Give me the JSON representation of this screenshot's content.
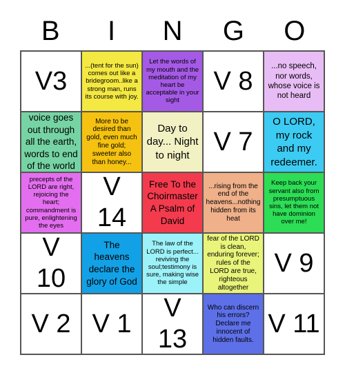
{
  "header": {
    "letters": [
      "B",
      "I",
      "N",
      "G",
      "O"
    ]
  },
  "cells": [
    {
      "text": "V3",
      "bg": "#ffffff"
    },
    {
      "text": "...(tent for the sun) comes out like a bridegroom..like a strong man, runs its course with joy.",
      "bg": "#f4e842"
    },
    {
      "text": "Let the words of my mouth and the meditation of my heart be acceptable in your sight",
      "bg": "#a55ae6"
    },
    {
      "text": "V 8",
      "bg": "#ffffff"
    },
    {
      "text": "...no speech, nor words, whose voice is not heard",
      "bg": "#e8bdf5"
    },
    {
      "text": "voice goes out through all the earth, words to end of the world",
      "bg": "#76d4a4"
    },
    {
      "text": "More to be desired than gold, even much fine gold; sweeter also than honey...",
      "bg": "#f5c211"
    },
    {
      "text": "Day to day... Night to night",
      "bg": "#f1f1c4"
    },
    {
      "text": "V 7",
      "bg": "#ffffff"
    },
    {
      "text": "O LORD, my rock and my redeemer.",
      "bg": "#3ccbf2"
    },
    {
      "text": "precepts of the LORD are right, rejoicing the heart; commandment is pure, enlightening the eyes",
      "bg": "#e46ef0"
    },
    {
      "text": "V 14",
      "bg": "#ffffff"
    },
    {
      "text": "Free To the Choirmaster A Psalm of David",
      "bg": "#f43b4e"
    },
    {
      "text": "...rising from the end of the heavens...nothing hidden from its heat",
      "bg": "#efb08a"
    },
    {
      "text": "Keep back your servant also from presumptuous sins, let them not have dominion over me!",
      "bg": "#2cdd55"
    },
    {
      "text": "V 10",
      "bg": "#ffffff"
    },
    {
      "text": "The heavens declare the glory of God",
      "bg": "#12a1e6"
    },
    {
      "text": "The law of the LORD is perfect... reviving the soul;testimony is sure, making wise the simple",
      "bg": "#9cf2f9"
    },
    {
      "text": "fear of the LORD is clean, enduring forever; rules of the LORD are true, righteous altogether",
      "bg": "#e8f47a"
    },
    {
      "text": "V 9",
      "bg": "#ffffff"
    },
    {
      "text": "V 2",
      "bg": "#ffffff"
    },
    {
      "text": "V 1",
      "bg": "#ffffff"
    },
    {
      "text": "V 13",
      "bg": "#ffffff"
    },
    {
      "text": "Who can discern his errors? Declare me innocent of hidden faults.",
      "bg": "#5d70e8"
    },
    {
      "text": "V 11",
      "bg": "#ffffff"
    }
  ]
}
